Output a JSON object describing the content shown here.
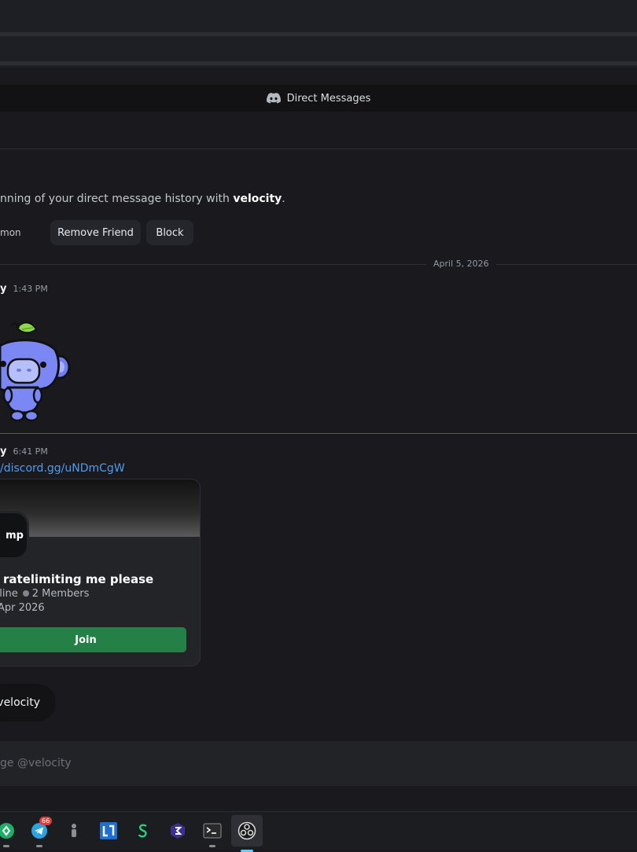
{
  "window": {
    "title": "Direct Messages"
  },
  "welcome": {
    "prefix": "nning of your direct message history with ",
    "username": "velocity",
    "suffix": "."
  },
  "actions": {
    "mutual_label": "mon",
    "remove_friend": "Remove Friend",
    "block": "Block"
  },
  "date_divider": "April 5, 2026",
  "messages": [
    {
      "author": "y",
      "time": "1:43 PM"
    },
    {
      "author": "y",
      "time": "6:41 PM",
      "link": "/discord.gg/uNDmCgW"
    }
  ],
  "invite": {
    "icon_text": "mp",
    "server_name": "ratelimiting me please",
    "online": "nline",
    "members": "2 Members",
    "date": "Apr 2026",
    "join_label": "Join"
  },
  "mention_pill": "velocity",
  "composer": {
    "placeholder": "ge @velocity"
  },
  "taskbar": {
    "telegram_badge": "66"
  },
  "colors": {
    "background": "#1a1a1e",
    "link": "#4e9cf0",
    "join": "#248046",
    "new_divider": "#a33a3a",
    "blurple": "#5865f2"
  }
}
